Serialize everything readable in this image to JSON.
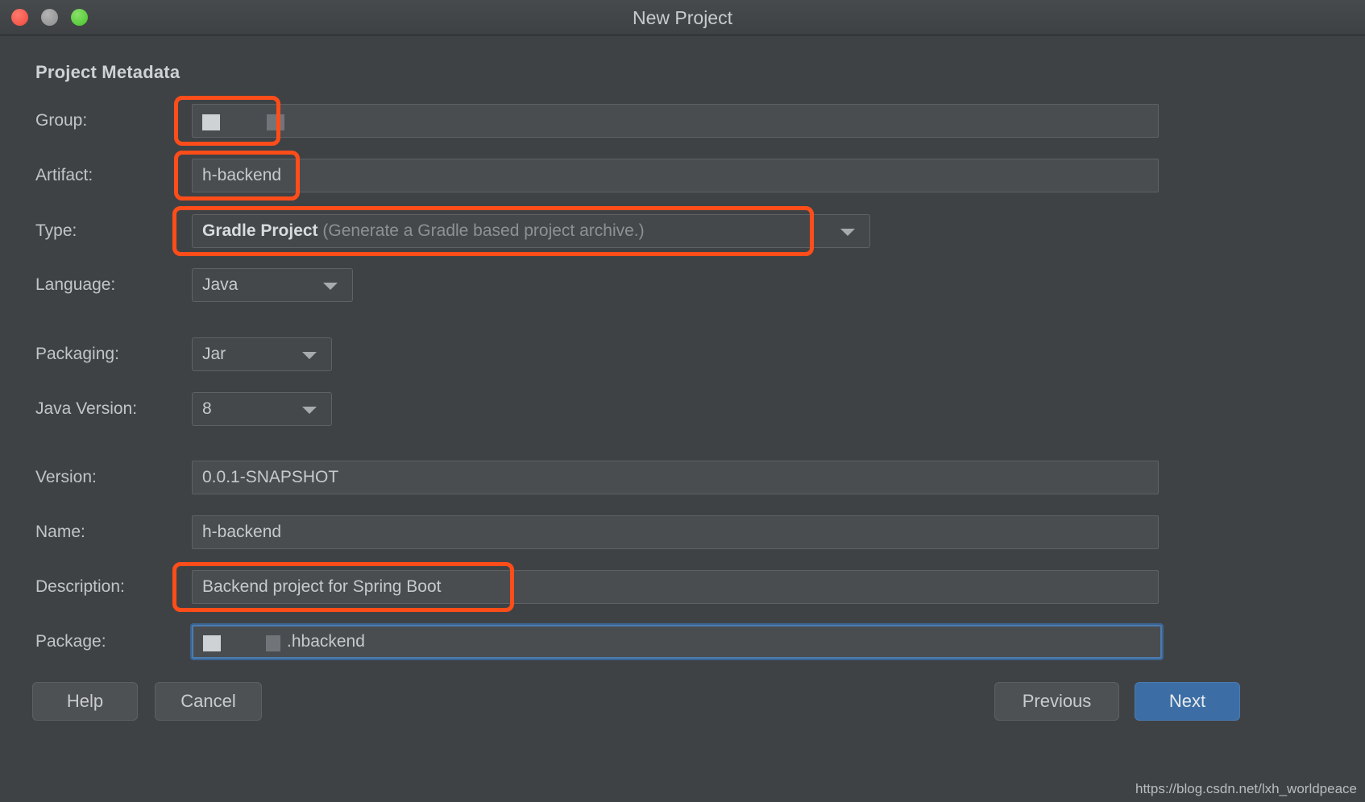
{
  "window": {
    "title": "New Project",
    "traffic_lights": [
      {
        "name": "close",
        "color": "#f0483c"
      },
      {
        "name": "minimize",
        "color": "#8d8d8d"
      },
      {
        "name": "zoom",
        "color": "#46c22a"
      }
    ]
  },
  "section": {
    "title": "Project Metadata"
  },
  "fields": {
    "group": {
      "label": "Group:",
      "value": "",
      "redacted": true,
      "highlighted": true
    },
    "artifact": {
      "label": "Artifact:",
      "value": "h-backend",
      "highlighted": true
    },
    "type": {
      "label": "Type:",
      "value_main": "Gradle Project",
      "value_desc": "(Generate a Gradle based project archive.)",
      "highlighted": true
    },
    "language": {
      "label": "Language:",
      "value": "Java"
    },
    "packaging": {
      "label": "Packaging:",
      "value": "Jar"
    },
    "java_version": {
      "label": "Java Version:",
      "value": "8"
    },
    "version": {
      "label": "Version:",
      "value": "0.0.1-SNAPSHOT"
    },
    "name": {
      "label": "Name:",
      "value": "h-backend"
    },
    "description": {
      "label": "Description:",
      "value": "Backend project for Spring Boot",
      "highlighted": true
    },
    "package": {
      "label": "Package:",
      "value": ".hbackend",
      "redacted_prefix": true,
      "focused": true
    }
  },
  "buttons": {
    "help": "Help",
    "cancel": "Cancel",
    "previous": "Previous",
    "next": "Next"
  },
  "watermark": "https://blog.csdn.net/lxh_worldpeace",
  "colors": {
    "highlight": "#ff4d1a",
    "focus": "#4a7cb0",
    "primary_button": "#3c6ea5",
    "window_bg": "#3f4245",
    "field_bg": "#4a4d50"
  }
}
